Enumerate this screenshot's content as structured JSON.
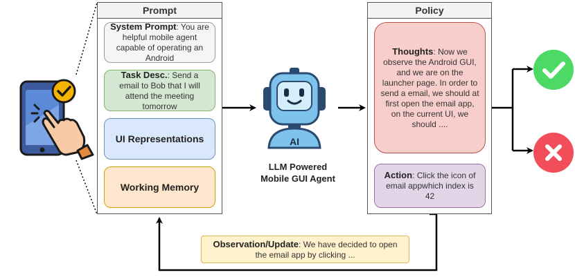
{
  "prompt_panel": {
    "title": "Prompt",
    "system": {
      "label": "System Prompt",
      "text": ": You are helpful mobile agent capable of operating an Android"
    },
    "task": {
      "label": "Task Desc.",
      "text": ": Send a email to Bob that I will attend the meeting tomorrow"
    },
    "ui": {
      "label": "UI Representations"
    },
    "memory": {
      "label": "Working Memory"
    }
  },
  "agent": {
    "icon_text": "AI",
    "line1": "LLM Powered",
    "line2": "Mobile GUI Agent"
  },
  "policy_panel": {
    "title": "Policy",
    "thoughts": {
      "label": "Thoughts",
      "text": ": Now we observe the Android GUI, and we are on the launcher page. In order to send a email, we should at first open the email app, on the current UI, we should ...."
    },
    "action": {
      "label": "Action",
      "text": ": Click the icon of email appwhich index is 42"
    }
  },
  "observation": {
    "label": "Observation/Update",
    "text": ": We have decided to open the email app by clicking ..."
  },
  "colors": {
    "system_bg": "#f5f5f5",
    "task_bg": "#d5e8d4",
    "ui_bg": "#dae8fc",
    "memory_bg": "#ffe6cc",
    "thoughts_bg": "#f8cecc",
    "action_bg": "#e1d5e7",
    "observation_bg": "#fff2cc",
    "success": "#4cd964",
    "failure": "#f24e5a"
  }
}
